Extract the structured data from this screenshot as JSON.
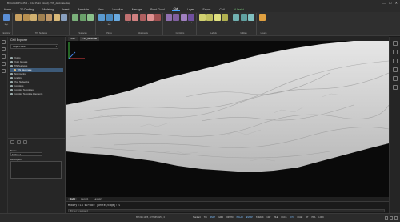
{
  "window": {
    "title": "BricsCAD Pro 25.2 - [Civil Point Cloud] - TIN_decimate.dwg",
    "controls": [
      "—",
      "☐",
      "✕"
    ]
  },
  "menu": {
    "tabs": [
      "Home",
      "2D Drafting",
      "Modeling",
      "Insert",
      "Annotate",
      "View",
      "Visualize",
      "Manage",
      "Point Cloud",
      "Civil",
      "Layer",
      "Export",
      "Civil",
      "AI Assist"
    ]
  },
  "ribbon": {
    "groups": [
      {
        "name": "Explorer",
        "labels": [
          "Civil Expl."
        ]
      },
      {
        "name": "TIN Surfaces",
        "labels": [
          "TIN",
          "Edit TIN",
          "Create",
          "Merge",
          "Simplify",
          "Decimate",
          "Volume"
        ]
      },
      {
        "name": "Surfaces",
        "labels": [
          "Grade",
          "Profile",
          "Section"
        ]
      },
      {
        "name": "Pipes",
        "labels": [
          "Pipe",
          "Pipe Edit",
          "Points"
        ]
      },
      {
        "name": "Alignments",
        "labels": [
          "Align",
          "Horiz.",
          "Vert.",
          "Corridor",
          "Attach"
        ]
      },
      {
        "name": "Corridors",
        "labels": [
          "Corridor",
          "Edit",
          "Template",
          "Target"
        ]
      },
      {
        "name": "Labels",
        "labels": [
          "Label",
          "Add",
          "Edit",
          "Style"
        ]
      },
      {
        "name": "Utilities",
        "labels": [
          "Import",
          "Export",
          "Units"
        ]
      },
      {
        "name": "Layers",
        "labels": [
          "Layer"
        ]
      }
    ]
  },
  "civil_explorer": {
    "title": "Civil Explorer",
    "dropdown": "Object view",
    "items": [
      "Points",
      "Point Groups",
      "TIN Surfaces",
      "TIN_decimate",
      "Alignments",
      "Grading",
      "Pipe Networks",
      "Corridors",
      "Corridor Templates",
      "Corridor Template Elements"
    ],
    "selected_index": 3,
    "name_label": "Name",
    "name_value": "Surface1",
    "description_label": "Description"
  },
  "doc_tabs": [
    "Start",
    "TIN_decimate"
  ],
  "layout_tabs": [
    "Model",
    "Layout1",
    "Layout2"
  ],
  "command_line": {
    "last": "Modify TIN surface [Vertex/Edge]: S",
    "prompt": "Enter command"
  },
  "status": {
    "coords": "897226.1425, 4377165.3251, 0",
    "toggles": [
      "Standard",
      "TIN",
      "SNAP",
      "GRID",
      "ORTHO",
      "POLAR",
      "ESNAP",
      "STRACK",
      "LWT",
      "TILE",
      "DUCS",
      "DYN",
      "QUAD",
      "RT",
      "HKA",
      "LOCK"
    ]
  },
  "colors": {
    "accent": "#4aa3ff",
    "viewport_bg": "#0a0a0a",
    "terrain": "#dcdcdc"
  }
}
